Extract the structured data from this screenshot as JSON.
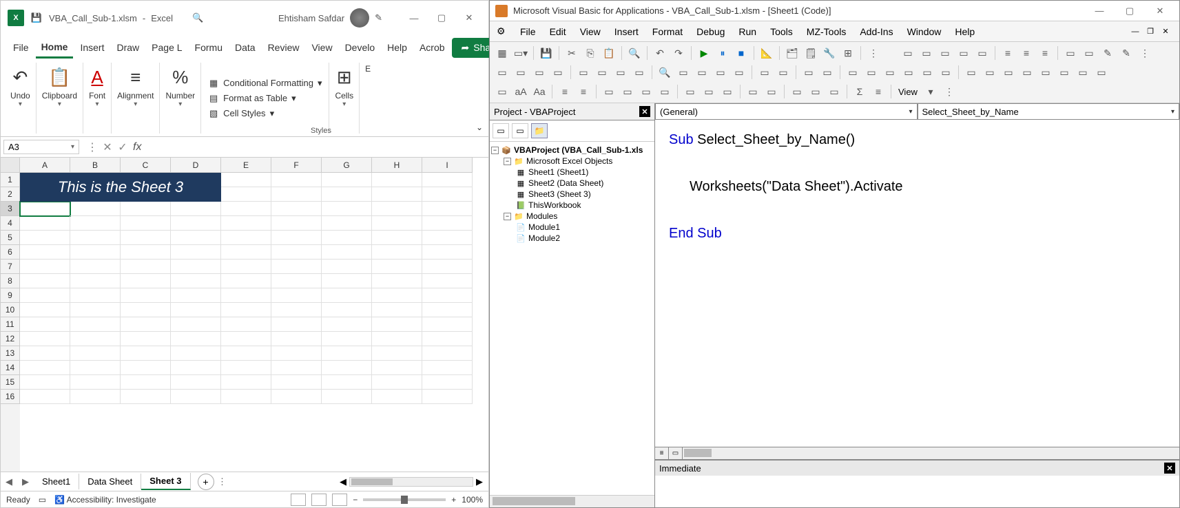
{
  "excel": {
    "titlebar": {
      "filename": "VBA_Call_Sub-1.xlsm",
      "app": "Excel",
      "user": "Ehtisham Safdar"
    },
    "ribbon_tabs": [
      "File",
      "Home",
      "Insert",
      "Draw",
      "Page L",
      "Formu",
      "Data",
      "Review",
      "View",
      "Develo",
      "Help",
      "Acrob"
    ],
    "active_tab": "Home",
    "share_label": "Share",
    "groups": {
      "undo": "Undo",
      "clipboard": "Clipboard",
      "font": "Font",
      "alignment": "Alignment",
      "number": "Number",
      "cells": "Cells",
      "editing": "E"
    },
    "styles": {
      "cond_format": "Conditional Formatting",
      "format_table": "Format as Table",
      "cell_styles": "Cell Styles",
      "label": "Styles"
    },
    "namebox": "A3",
    "formula": "",
    "columns": [
      "A",
      "B",
      "C",
      "D",
      "E",
      "F",
      "G",
      "H",
      "I"
    ],
    "row_count": 16,
    "banner_text": "This is the Sheet 3",
    "selected_cell": "A3",
    "sheet_tabs": [
      "Sheet1",
      "Data Sheet",
      "Sheet 3"
    ],
    "active_sheet": "Sheet 3",
    "status": {
      "ready": "Ready",
      "accessibility": "Accessibility: Investigate",
      "zoom": "100%"
    }
  },
  "vba": {
    "title": "Microsoft Visual Basic for Applications - VBA_Call_Sub-1.xlsm - [Sheet1 (Code)]",
    "menus": [
      "File",
      "Edit",
      "View",
      "Insert",
      "Format",
      "Debug",
      "Run",
      "Tools",
      "MZ-Tools",
      "Add-Ins",
      "Window",
      "Help"
    ],
    "view_label": "View",
    "project_pane_title": "Project - VBAProject",
    "tree": {
      "root": "VBAProject (VBA_Call_Sub-1.xls",
      "excel_objects": "Microsoft Excel Objects",
      "sheets": [
        "Sheet1 (Sheet1)",
        "Sheet2 (Data Sheet)",
        "Sheet3 (Sheet 3)"
      ],
      "thisworkbook": "ThisWorkbook",
      "modules_label": "Modules",
      "modules": [
        "Module1",
        "Module2"
      ]
    },
    "code_dd_left": "(General)",
    "code_dd_right": "Select_Sheet_by_Name",
    "code": {
      "line1_kw": "Sub",
      "line1_rest": " Select_Sheet_by_Name()",
      "line2": "Worksheets(\"Data Sheet\").Activate",
      "line3": "End Sub"
    },
    "immediate_title": "Immediate"
  }
}
